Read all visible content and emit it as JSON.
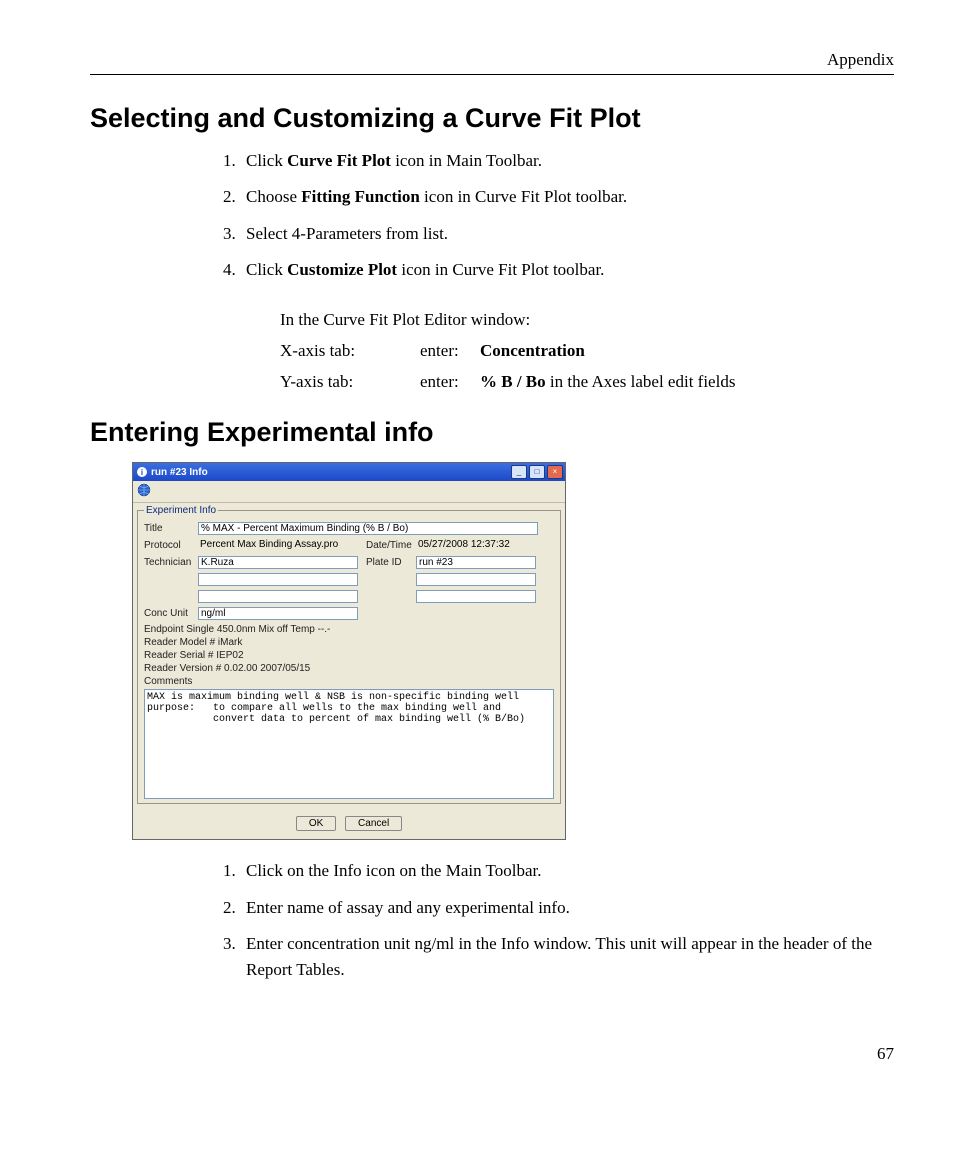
{
  "header": {
    "right": "Appendix"
  },
  "section1": {
    "heading": "Selecting and Customizing a Curve Fit Plot",
    "steps": [
      {
        "pre": "Click ",
        "b": "Curve Fit Plot",
        "post": " icon in Main Toolbar."
      },
      {
        "pre": "Choose ",
        "b": "Fitting Function",
        "post": " icon in Curve Fit Plot toolbar."
      },
      {
        "pre": "Select 4-Parameters from list.",
        "b": "",
        "post": ""
      },
      {
        "pre": "Click ",
        "b": "Customize Plot",
        "post": " icon in Curve Fit Plot toolbar."
      }
    ],
    "sub": {
      "intro": "In the Curve Fit Plot Editor window:",
      "rows": [
        {
          "c1": "X-axis tab:",
          "c2": "enter:",
          "b": "Concentration",
          "post": ""
        },
        {
          "c1": "Y-axis tab:",
          "c2": "enter:",
          "b": "%  B / Bo",
          "post": " in the Axes label edit fields"
        }
      ]
    }
  },
  "section2": {
    "heading": "Entering Experimental info",
    "steps": [
      "Click on the Info icon on the Main Toolbar.",
      "Enter name of assay and any experimental info.",
      "Enter concentration unit  ng/ml  in the Info window.  This unit will appear in the header of the Report Tables."
    ]
  },
  "dialog": {
    "title": "run #23  Info",
    "legend": "Experiment Info",
    "labels": {
      "title": "Title",
      "protocol": "Protocol",
      "technician": "Technician",
      "datetime": "Date/Time",
      "plateid": "Plate ID",
      "concunit": "Conc Unit",
      "comments": "Comments"
    },
    "values": {
      "title": "% MAX - Percent Maximum Binding (% B / Bo)",
      "protocol": "Percent Max Binding Assay.pro",
      "technician": "K.Ruza",
      "datetime": "05/27/2008 12:37:32",
      "plateid": "run #23",
      "concunit": "ng/ml"
    },
    "static": [
      "Endpoint Single 450.0nm  Mix off Temp --.-",
      "Reader Model # iMark",
      "Reader Serial # IEP02",
      "Reader Version # 0.02.00 2007/05/15"
    ],
    "comments_text": "MAX is maximum binding well & NSB is non-specific binding well\npurpose:   to compare all wells to the max binding well and\n           convert data to percent of max binding well (% B/Bo)",
    "buttons": {
      "ok": "OK",
      "cancel": "Cancel"
    }
  },
  "pagenum": "67"
}
